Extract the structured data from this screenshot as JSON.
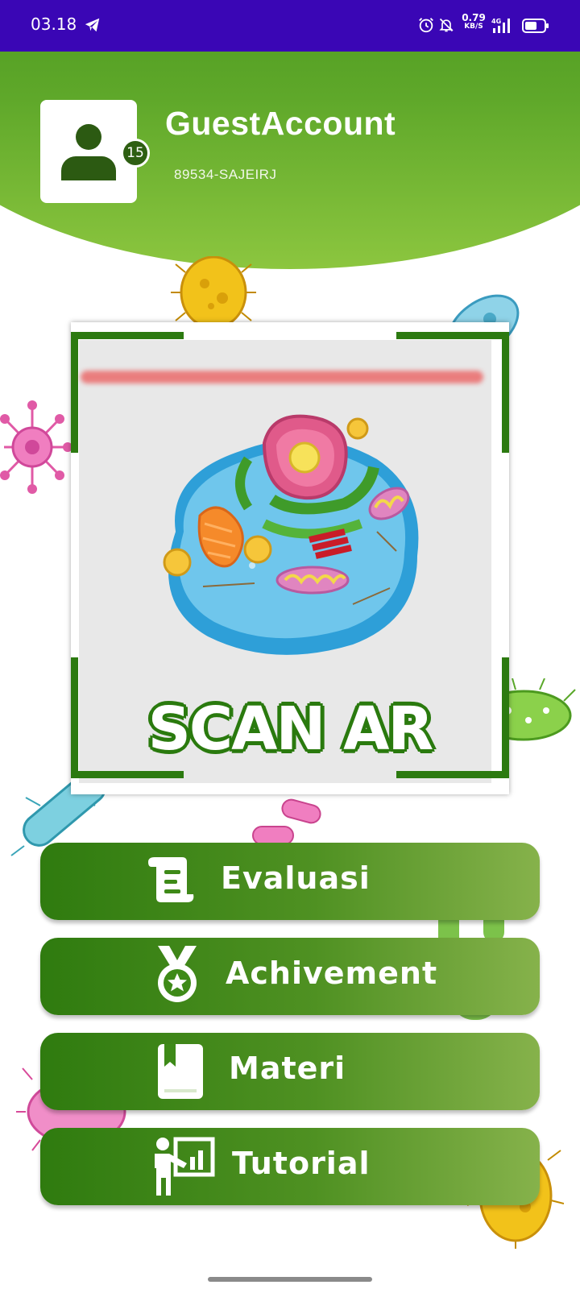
{
  "status_bar": {
    "time": "03.18",
    "net_speed_value": "0.79",
    "net_speed_unit": "KB/S",
    "network_type": "4G",
    "icons": [
      "telegram-icon",
      "alarm-icon",
      "bell-off-icon",
      "signal-icon",
      "battery-icon"
    ]
  },
  "profile": {
    "username": "GuestAccount",
    "user_code": "89534-SAJEIRJ",
    "level": "15",
    "avatar_icon": "user-icon"
  },
  "scanner": {
    "label": "SCAN AR",
    "image": "animal-cell-illustration"
  },
  "menu": [
    {
      "label": "Evaluasi",
      "icon": "scroll-icon"
    },
    {
      "label": "Achivement",
      "icon": "medal-icon"
    },
    {
      "label": "Materi",
      "icon": "book-icon"
    },
    {
      "label": "Tutorial",
      "icon": "presentation-icon"
    }
  ],
  "colors": {
    "status_bar": "#3a06b5",
    "primary_green": "#3e8e17",
    "light_green": "#8cc63f",
    "scanner_frame": "#2c7a10",
    "scan_line": "#eb5050"
  }
}
